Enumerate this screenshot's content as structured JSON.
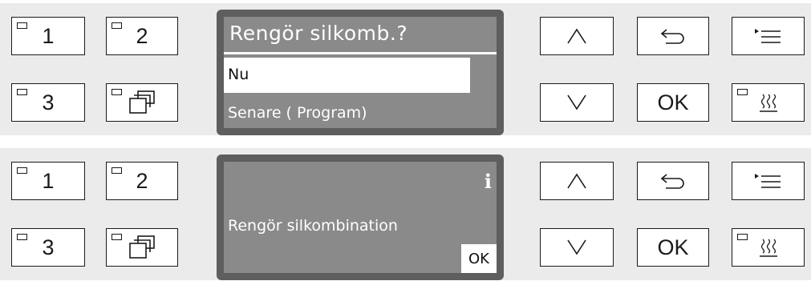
{
  "panels": [
    {
      "buttons": {
        "one": "1",
        "two": "2",
        "three": "3",
        "ok": "OK"
      },
      "display": {
        "title": "Rengör silkomb.?",
        "options": [
          "Nu",
          "Senare ( Program)"
        ],
        "selected_index": 0
      },
      "icons": {
        "programs": "program-list-icon",
        "up": "arrow-up-icon",
        "back": "back-arrow-icon",
        "menu": "menu-icon",
        "down": "arrow-down-icon",
        "dry": "drying-icon"
      }
    },
    {
      "buttons": {
        "one": "1",
        "two": "2",
        "three": "3",
        "ok": "OK"
      },
      "display": {
        "info_icon": "i",
        "message": "Rengör silkombination",
        "ok_label": "OK"
      },
      "icons": {
        "programs": "program-list-icon",
        "up": "arrow-up-icon",
        "back": "back-arrow-icon",
        "menu": "menu-icon",
        "down": "arrow-down-icon",
        "dry": "drying-icon",
        "info": "info-icon"
      }
    }
  ],
  "colors": {
    "panel_bg": "#ebebeb",
    "display_frame": "#5e5e5e",
    "display_screen": "#8a8a8a",
    "highlight": "#ffffff"
  }
}
